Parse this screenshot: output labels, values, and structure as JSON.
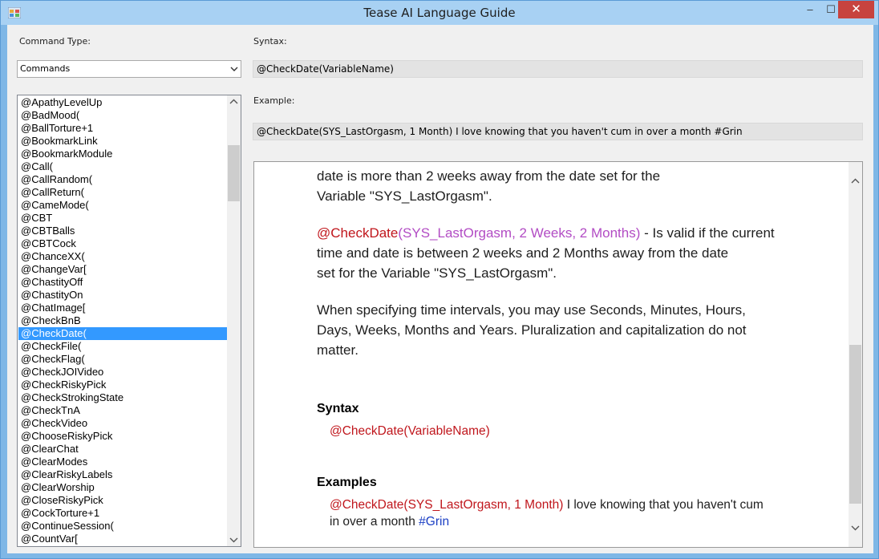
{
  "window": {
    "title": "Tease AI Language Guide",
    "minimize": "–",
    "maximize": "☐",
    "close": "✕"
  },
  "left": {
    "command_type_label": "Command Type:",
    "command_type_value": "Commands",
    "commands": [
      "@ApathyLevelUp",
      "@BadMood(",
      "@BallTorture+1",
      "@BookmarkLink",
      "@BookmarkModule",
      "@Call(",
      "@CallRandom(",
      "@CallReturn(",
      "@CameMode(",
      "@CBT",
      "@CBTBalls",
      "@CBTCock",
      "@ChanceXX(",
      "@ChangeVar[",
      "@ChastityOff",
      "@ChastityOn",
      "@ChatImage[",
      "@CheckBnB",
      "@CheckDate(",
      "@CheckFile(",
      "@CheckFlag(",
      "@CheckJOIVideo",
      "@CheckRiskyPick",
      "@CheckStrokingState",
      "@CheckTnA",
      "@CheckVideo",
      "@ChooseRiskyPick",
      "@ClearChat",
      "@ClearModes",
      "@ClearRiskyLabels",
      "@ClearWorship",
      "@CloseRiskyPick",
      "@CockTorture+1",
      "@ContinueSession(",
      "@CountVar["
    ],
    "selected_index": 18
  },
  "right": {
    "syntax_label": "Syntax:",
    "syntax_value": "@CheckDate(VariableName)",
    "example_label": "Example:",
    "example_value": "@CheckDate(SYS_LastOrgasm, 1 Month) I love knowing that you haven't cum in over a month #Grin"
  },
  "doc": {
    "para1_line1": "date is more than 2 weeks away from the date set for the",
    "para1_line2": "Variable \"SYS_LastOrgasm\".",
    "para2_cmd": "@CheckDate",
    "para2_args": "(SYS_LastOrgasm, 2 Weeks, 2 Months)",
    "para2_line1_rest": " - Is valid if the current",
    "para2_line2": "time and date is between 2 weeks and 2 Months away from the date",
    "para2_line3": "set for the Variable \"SYS_LastOrgasm\".",
    "para3_line1": "When specifying time intervals, you may use Seconds, Minutes, Hours,",
    "para3_line2": "Days, Weeks, Months and Years. Pluralization and capitalization do not",
    "para3_line3": "matter.",
    "syntax_heading": "Syntax",
    "syntax_code": "@CheckDate(VariableName)",
    "examples_heading": "Examples",
    "example_cmd": "@CheckDate(SYS_LastOrgasm, 1 Month)",
    "example_text_line1": " I love knowing that you haven't cum",
    "example_text_line2": "in over a month ",
    "example_hashtag": "#Grin"
  },
  "colors": {
    "command": "#c0161c",
    "argument": "#b24cc4",
    "hashtag": "#1a3ec4",
    "selection": "#3399ff",
    "close_button": "#c7433f"
  }
}
